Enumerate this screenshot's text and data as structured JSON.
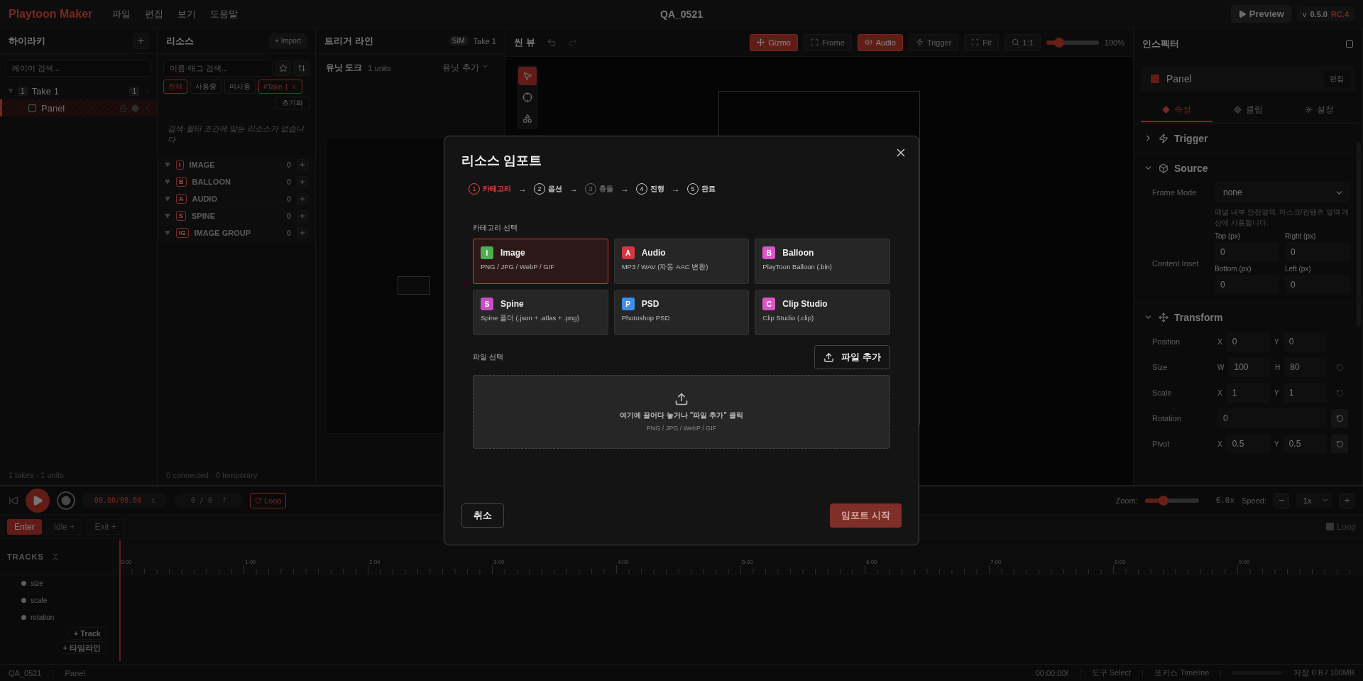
{
  "app": {
    "logo": "Playtoon Maker",
    "menu": [
      "파일",
      "편집",
      "보기",
      "도움말"
    ],
    "title": "QA_0521",
    "preview": "Preview",
    "version_prefix": "v",
    "version": "0.5.0",
    "release": "RC.4"
  },
  "hierarchy": {
    "title": "하이라키",
    "search_placeholder": "레이어 검색...",
    "tree": [
      {
        "badge": "1",
        "label": "Take 1",
        "count": "1",
        "expanded": true,
        "selected": false,
        "children": [
          {
            "label": "Panel",
            "selected": true
          }
        ]
      }
    ],
    "footer": "1 takes · 1 units"
  },
  "resources": {
    "title": "리소스",
    "import": "+ Import",
    "search_placeholder": "이름·태그 검색...",
    "filters": [
      {
        "label": "전체",
        "selected": true
      },
      {
        "label": "사용중",
        "selected": false
      },
      {
        "label": "미사용",
        "selected": false
      }
    ],
    "tag": "#Take 1",
    "reset": "초기화",
    "empty": "검색·필터 조건에 맞는 리소스가 없습니다",
    "groups": [
      {
        "badge": "I",
        "label": "IMAGE",
        "count": "0"
      },
      {
        "badge": "B",
        "label": "BALLOON",
        "count": "0"
      },
      {
        "badge": "A",
        "label": "AUDIO",
        "count": "0"
      },
      {
        "badge": "S",
        "label": "SPINE",
        "count": "0"
      },
      {
        "badge": "IG",
        "label": "IMAGE GROUP",
        "count": "0"
      }
    ],
    "footer": "0 connected · 0 temporary"
  },
  "trigger": {
    "title": "트리거 라인",
    "sim": "SIM",
    "take": "Take 1",
    "dock": "유닛 도크",
    "units": "1 units",
    "add_unit": "유닛 추가"
  },
  "scene": {
    "title": "씬 뷰",
    "tools": [
      {
        "label": "Gizmo",
        "on": true
      },
      {
        "label": "Frame",
        "on": false
      },
      {
        "label": "Audio",
        "on": true
      },
      {
        "label": "Trigger",
        "on": false
      }
    ],
    "fit": "Fit",
    "zoom_label": "1:1",
    "zoom": {
      "level": 0.25
    },
    "zoom_reading": "100%",
    "palette": [
      {
        "selected": true
      },
      {
        "selected": false
      },
      {
        "selected": false
      }
    ]
  },
  "inspector": {
    "title": "인스펙터",
    "object": "Panel",
    "edit": "편집",
    "tabs": [
      {
        "label": "속성",
        "selected": true
      },
      {
        "label": "클립",
        "selected": false
      },
      {
        "label": "설정",
        "selected": false
      }
    ],
    "trigger_section": {
      "title": "Trigger",
      "expanded": false
    },
    "source_section": {
      "title": "Source",
      "expanded": true,
      "frame_mode_label": "Frame Mode",
      "frame_mode": "none",
      "hint": "패널 내부 안전영역. 마스크/컨텐츠 영역 계산에 사용됩니다.",
      "inset_label": "Content Inset",
      "insets": [
        {
          "label": "Top (px)",
          "value": "0"
        },
        {
          "label": "Right (px)",
          "value": "0"
        },
        {
          "label": "Bottom (px)",
          "value": "0"
        },
        {
          "label": "Left (px)",
          "value": "0"
        }
      ]
    },
    "transform_section": {
      "title": "Transform",
      "expanded": true,
      "rows": [
        {
          "label": "Position",
          "kind": "pair",
          "fields": [
            {
              "axis": "X",
              "value": "0"
            },
            {
              "axis": "Y",
              "value": "0"
            }
          ]
        },
        {
          "label": "Size",
          "kind": "pair_reset",
          "reset_enabled": false,
          "fields": [
            {
              "axis": "W",
              "value": "100"
            },
            {
              "axis": "H",
              "value": "80"
            }
          ]
        },
        {
          "label": "Scale",
          "kind": "pair_reset",
          "reset_enabled": false,
          "fields": [
            {
              "axis": "X",
              "value": "1"
            },
            {
              "axis": "Y",
              "value": "1"
            }
          ]
        },
        {
          "label": "Rotation",
          "kind": "single_reset",
          "reset_enabled": true,
          "value": "0"
        },
        {
          "label": "Pivot",
          "kind": "pair_reset",
          "reset_enabled": true,
          "fields": [
            {
              "axis": "X",
              "value": "0.5"
            },
            {
              "axis": "Y",
              "value": "0.5"
            }
          ]
        }
      ]
    }
  },
  "timeline": {
    "time": "00.00/00.00",
    "time_unit": "s",
    "frame": "0 / 0",
    "frame_unit": "f",
    "loop": "Loop",
    "zoom_label": "Zoom:",
    "zoom": {
      "level": 0.35
    },
    "zoom_reading": "6.0x",
    "speed_label": "Speed:",
    "speed": "1x",
    "clips": [
      {
        "label": "Enter",
        "selected": true
      },
      {
        "label": "Idle +",
        "selected": false
      },
      {
        "label": "Exit +",
        "selected": false
      }
    ],
    "loop_toggle": {
      "label": "Loop",
      "checked": false
    },
    "tracks_title": "TRACKS",
    "ruler": [
      "0:00",
      "1:00",
      "2:00",
      "3:00",
      "4:00",
      "5:00",
      "6:00",
      "7:00",
      "8:00",
      "9:00"
    ],
    "tracks": [
      {
        "label": "size"
      },
      {
        "label": "scale"
      },
      {
        "label": "rotation"
      }
    ],
    "add_track": "+ Track",
    "add_timeline": "+ 타임라인"
  },
  "status": {
    "project": "QA_0521",
    "selection": "Panel",
    "time": "00:00:00f",
    "tool": "도구 Select",
    "focus": "포커스 Timeline",
    "storage": "저장 0 B / 100MB"
  },
  "modal": {
    "title": "리소스 임포트",
    "step_separator": "→",
    "steps": [
      {
        "num": "1",
        "label": "카테고리",
        "selected": true,
        "disabled": false
      },
      {
        "num": "2",
        "label": "옵션",
        "selected": false,
        "disabled": false
      },
      {
        "num": "3",
        "label": "충돌",
        "selected": false,
        "disabled": true
      },
      {
        "num": "4",
        "label": "진행",
        "selected": false,
        "disabled": false
      },
      {
        "num": "5",
        "label": "완료",
        "selected": false,
        "disabled": false
      }
    ],
    "category_label": "카테고리 선택",
    "categories": [
      {
        "letter": "I",
        "name": "Image",
        "desc": "PNG / JPG / WebP / GIF",
        "color": "#4caf50",
        "selected": true
      },
      {
        "letter": "A",
        "name": "Audio",
        "desc": "MP3 / WAV (자동 AAC 변환)",
        "color": "#d6363f",
        "selected": false
      },
      {
        "letter": "B",
        "name": "Balloon",
        "desc": "PlayToon Balloon (.bln)",
        "color": "#d957c8",
        "selected": false
      },
      {
        "letter": "S",
        "name": "Spine",
        "desc": "Spine 폴더 (.json + .atlas + .png)",
        "color": "#c94fc6",
        "selected": false
      },
      {
        "letter": "P",
        "name": "PSD",
        "desc": "Photoshop PSD",
        "color": "#3d8fe8",
        "selected": false
      },
      {
        "letter": "C",
        "name": "Clip Studio",
        "desc": "Clip Studio (.clip)",
        "color": "#d957c8",
        "selected": false
      }
    ],
    "file_label": "파일 선택",
    "add_file": "파일 추가",
    "drop_text": "여기에 끌어다 놓거나 \"파일 추가\" 클릭",
    "drop_formats": "PNG / JPG / WebP / GIF",
    "cancel": "취소",
    "start": "임포트 시작",
    "start_disabled": true
  }
}
